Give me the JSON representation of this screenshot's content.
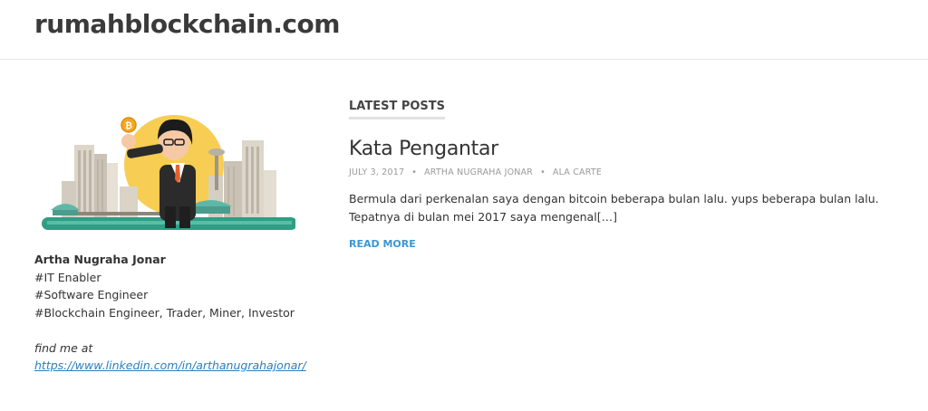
{
  "site": {
    "title": "rumahblockchain.com"
  },
  "sidebar": {
    "author_name": "Artha Nugraha Jonar",
    "lines": [
      "#IT Enabler",
      "#Software Engineer",
      "#Blockchain Engineer, Trader, Miner, Investor"
    ],
    "find_me": "find me at",
    "link": "https://www.linkedin.com/in/arthanugrahajonar/"
  },
  "main": {
    "section_label": "LATEST POSTS",
    "post": {
      "title": "Kata Pengantar",
      "date": "JULY 3, 2017",
      "author": "ARTHA NUGRAHA JONAR",
      "category": "ALA CARTE",
      "excerpt": "Bermula dari perkenalan saya dengan bitcoin beberapa bulan lalu. yups beberapa bulan lalu. Tepatnya di bulan mei 2017 saya mengenal[…]",
      "read_more": "READ MORE"
    }
  },
  "colors": {
    "link": "#2a7fc1",
    "read_more": "#3a97d4",
    "title": "#3a3a3a",
    "meta": "#9a9a9a"
  }
}
